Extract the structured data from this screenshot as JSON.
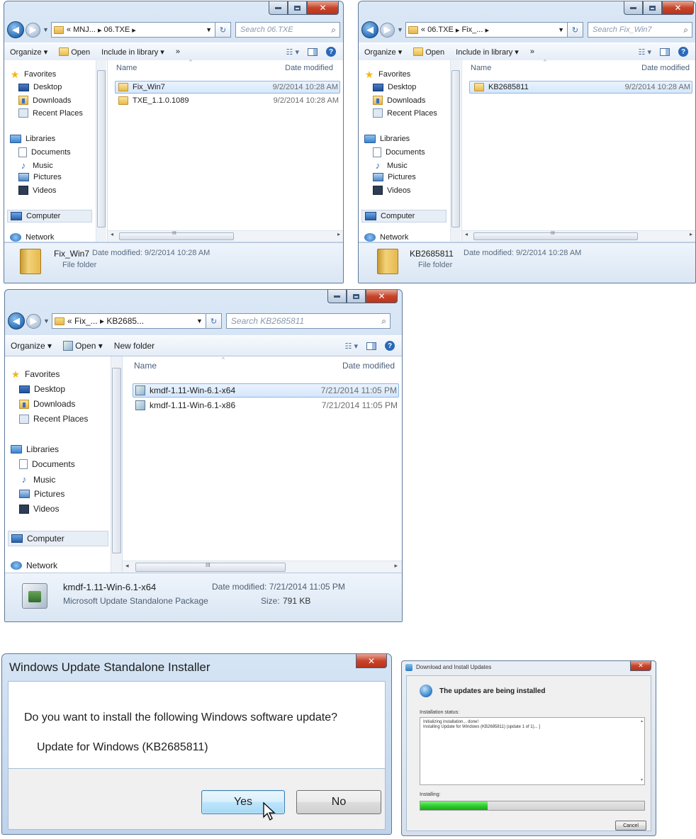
{
  "explorer_windows": [
    {
      "addr_parts": [
        "«",
        "MNJ...",
        "▸",
        "06.TXE",
        "▸"
      ],
      "search_placeholder": "Search 06.TXE",
      "toolbar": [
        "Organize ▾",
        "Open",
        "Include in library ▾",
        "»"
      ],
      "col_name": "Name",
      "col_date": "Date modified",
      "nav": [
        "Favorites",
        "Desktop",
        "Downloads",
        "Recent Places",
        "Libraries",
        "Documents",
        "Music",
        "Pictures",
        "Videos",
        "Computer",
        "Network"
      ],
      "files": [
        {
          "name": "Fix_Win7",
          "date": "9/2/2014 10:28 AM"
        },
        {
          "name": "TXE_1.1.0.1089",
          "date": "9/2/2014 10:28 AM"
        }
      ],
      "status_name": "Fix_Win7",
      "status_date": "Date modified: 9/2/2014 10:28 AM",
      "status_type": "File folder",
      "scroll_mark": "III"
    },
    {
      "addr_parts": [
        "«",
        "06.TXE",
        "▸",
        "Fix_...",
        "▸"
      ],
      "search_placeholder": "Search Fix_Win7",
      "toolbar": [
        "Organize ▾",
        "Open",
        "Include in library ▾",
        "»"
      ],
      "col_name": "Name",
      "col_date": "Date modified",
      "nav": [
        "Favorites",
        "Desktop",
        "Downloads",
        "Recent Places",
        "Libraries",
        "Documents",
        "Music",
        "Pictures",
        "Videos",
        "Computer",
        "Network"
      ],
      "files": [
        {
          "name": "KB2685811",
          "date": "9/2/2014 10:28 AM"
        }
      ],
      "status_name": "KB2685811",
      "status_date": "Date modified: 9/2/2014 10:28 AM",
      "status_type": "File folder",
      "scroll_mark": "III"
    },
    {
      "addr_parts": [
        "«",
        "Fix_...",
        "▸",
        "KB2685...",
        ""
      ],
      "search_placeholder": "Search KB2685811",
      "toolbar": [
        "Organize ▾",
        "Open ▾",
        "New folder"
      ],
      "col_name": "Name",
      "col_date": "Date modified",
      "nav": [
        "Favorites",
        "Desktop",
        "Downloads",
        "Recent Places",
        "Libraries",
        "Documents",
        "Music",
        "Pictures",
        "Videos",
        "Computer",
        "Network"
      ],
      "files": [
        {
          "name": "kmdf-1.11-Win-6.1-x64",
          "date": "7/21/2014 11:05 PM"
        },
        {
          "name": "kmdf-1.11-Win-6.1-x86",
          "date": "7/21/2014 11:05 PM"
        }
      ],
      "status_name": "kmdf-1.11-Win-6.1-x64",
      "status_date": "Date modified: 7/21/2014 11:05 PM",
      "status_type": "Microsoft Update Standalone Package",
      "status_size_label": "Size:",
      "status_size": "791 KB",
      "scroll_mark": "III"
    }
  ],
  "wusa_dialog": {
    "title": "Windows Update Standalone Installer",
    "question": "Do you want to install the following Windows software update?",
    "update_name": "Update for Windows (KB2685811)",
    "yes_label": "Yes",
    "no_label": "No"
  },
  "install_dialog": {
    "title": "Download and Install Updates",
    "heading": "The updates are being installed",
    "status_label": "Installation status:",
    "log_lines": [
      "Initializing installation... done!",
      "Installing Update for Windows (KB2685811) (update 1 of 1)... ]"
    ],
    "progress_label": "Installing:",
    "progress_fraction": 0.3,
    "cancel_label": "Cancel"
  },
  "colors": {
    "progress": "#2fcf2f",
    "selection": "#d5e7fb",
    "close_button": "#c7452b"
  }
}
